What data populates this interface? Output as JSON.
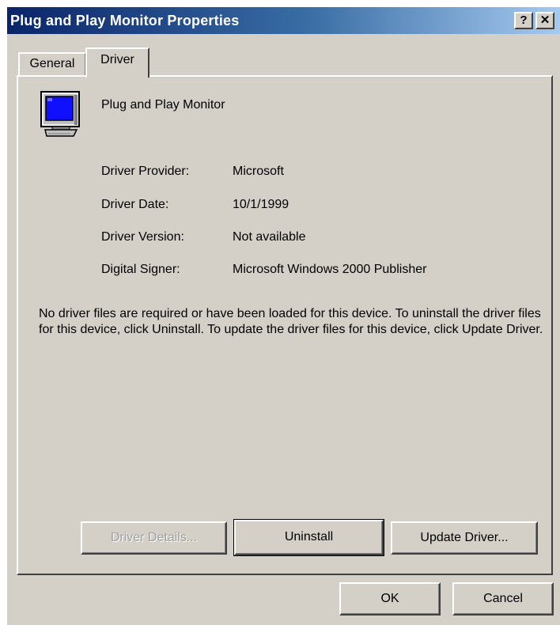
{
  "window": {
    "title": "Plug and Play Monitor Properties",
    "help_glyph": "?",
    "close_glyph": "✕"
  },
  "tabs": [
    {
      "label": "General",
      "selected": false
    },
    {
      "label": "Driver",
      "selected": true
    }
  ],
  "device": {
    "name": "Plug and Play Monitor",
    "icon": "monitor-icon"
  },
  "driver_info": [
    {
      "label": "Driver Provider:",
      "value": "Microsoft"
    },
    {
      "label": "Driver Date:",
      "value": "10/1/1999"
    },
    {
      "label": "Driver Version:",
      "value": "Not available"
    },
    {
      "label": "Digital Signer:",
      "value": "Microsoft Windows 2000 Publisher"
    }
  ],
  "description": "No driver files are required or have been loaded for this device. To uninstall the driver files for this device, click Uninstall. To update the driver files for this device, click Update Driver.",
  "buttons": {
    "driver_details": "Driver Details...",
    "uninstall": "Uninstall",
    "update_driver": "Update Driver...",
    "ok": "OK",
    "cancel": "Cancel"
  },
  "colors": {
    "dialog_face": "#d4d0c8",
    "title_gradient_start": "#0a246a",
    "title_gradient_end": "#a6caf0",
    "disabled_text": "#a0a0a0"
  }
}
